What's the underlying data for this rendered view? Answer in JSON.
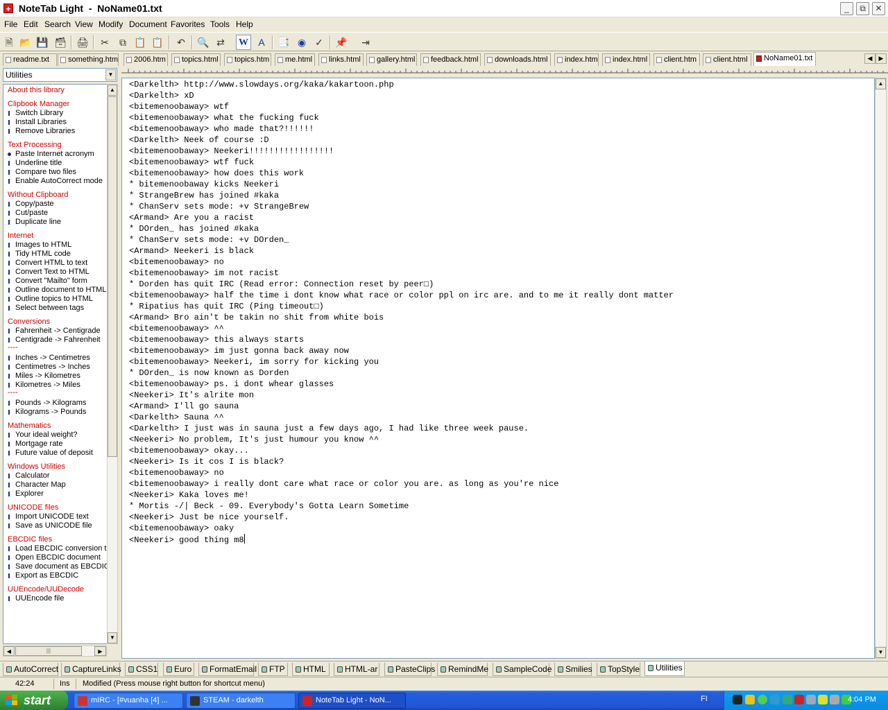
{
  "window": {
    "title": "NoteTab Light  -  NoName01.txt"
  },
  "menu": [
    "File",
    "Edit",
    "Search",
    "View",
    "Modify",
    "Document",
    "Favorites",
    "Tools",
    "Help"
  ],
  "toolbar": {
    "icons": [
      "new-icon",
      "open-icon",
      "save-icon",
      "save-all-icon",
      "print-icon",
      "cut-icon",
      "copy-icon",
      "paste-icon",
      "paste-special-icon",
      "undo-icon",
      "find-icon",
      "replace-icon",
      "word-wrap-icon",
      "font-icon",
      "outline-icon",
      "preview-icon",
      "spell-check-icon",
      "clipbook-icon",
      "exit-icon"
    ]
  },
  "tabs": [
    "readme.txt",
    "something.html",
    "2006.htm",
    "topics.html",
    "topics.htm",
    "me.html",
    "links.html",
    "gallery.html",
    "feedback.html",
    "downloads.html",
    "index.htm",
    "index.html",
    "client.htm",
    "client.html",
    "NoName01.txt"
  ],
  "library": {
    "selected": "Utilities"
  },
  "clip_items": [
    {
      "t": "h",
      "v": "About this library"
    },
    {
      "t": "g"
    },
    {
      "t": "h",
      "v": "Clipbook Manager"
    },
    {
      "t": "i",
      "v": "Switch Library"
    },
    {
      "t": "i",
      "v": "Install Libraries"
    },
    {
      "t": "i",
      "v": "Remove Libraries"
    },
    {
      "t": "g"
    },
    {
      "t": "h",
      "v": "Text Processing"
    },
    {
      "t": "b",
      "v": "Paste Internet acronym"
    },
    {
      "t": "i",
      "v": "Underline title"
    },
    {
      "t": "i",
      "v": "Compare two files"
    },
    {
      "t": "i",
      "v": "Enable AutoCorrect mode"
    },
    {
      "t": "g"
    },
    {
      "t": "h",
      "v": "Without Clipboard"
    },
    {
      "t": "i",
      "v": "Copy/paste"
    },
    {
      "t": "i",
      "v": "Cut/paste"
    },
    {
      "t": "i",
      "v": "Duplicate line"
    },
    {
      "t": "g"
    },
    {
      "t": "h",
      "v": "Internet"
    },
    {
      "t": "i",
      "v": "Images to HTML"
    },
    {
      "t": "i",
      "v": "Tidy HTML code"
    },
    {
      "t": "i",
      "v": "Convert HTML to text"
    },
    {
      "t": "i",
      "v": "Convert Text to HTML"
    },
    {
      "t": "i",
      "v": "Convert \"Mailto\" form"
    },
    {
      "t": "i",
      "v": "Outline document to HTML"
    },
    {
      "t": "i",
      "v": "Outline topics to HTML"
    },
    {
      "t": "i",
      "v": "Select between tags"
    },
    {
      "t": "g"
    },
    {
      "t": "h",
      "v": "Conversions"
    },
    {
      "t": "i",
      "v": "Fahrenheit -> Centigrade"
    },
    {
      "t": "i",
      "v": "Centigrade -> Fahrenheit"
    },
    {
      "t": "s",
      "v": "----"
    },
    {
      "t": "i",
      "v": "Inches -> Centimetres"
    },
    {
      "t": "i",
      "v": "Centimetres -> Inches"
    },
    {
      "t": "i",
      "v": "Miles -> Kilometres"
    },
    {
      "t": "i",
      "v": "Kilometres -> Miles"
    },
    {
      "t": "s",
      "v": "----"
    },
    {
      "t": "i",
      "v": "Pounds -> Kilograms"
    },
    {
      "t": "i",
      "v": "Kilograms -> Pounds"
    },
    {
      "t": "g"
    },
    {
      "t": "h",
      "v": "Mathematics"
    },
    {
      "t": "i",
      "v": "Your ideal weight?"
    },
    {
      "t": "i",
      "v": "Mortgage rate"
    },
    {
      "t": "i",
      "v": "Future value of deposit"
    },
    {
      "t": "g"
    },
    {
      "t": "h",
      "v": "Windows Utilities"
    },
    {
      "t": "i",
      "v": "Calculator"
    },
    {
      "t": "i",
      "v": "Character Map"
    },
    {
      "t": "i",
      "v": "Explorer"
    },
    {
      "t": "g"
    },
    {
      "t": "h",
      "v": "UNICODE files"
    },
    {
      "t": "i",
      "v": "Import UNICODE text"
    },
    {
      "t": "i",
      "v": "Save as UNICODE file"
    },
    {
      "t": "g"
    },
    {
      "t": "h",
      "v": "EBCDIC files"
    },
    {
      "t": "i",
      "v": "Load EBCDIC conversion t"
    },
    {
      "t": "i",
      "v": "Open EBCDIC document"
    },
    {
      "t": "i",
      "v": "Save document as EBCDIC"
    },
    {
      "t": "i",
      "v": "Export as EBCDIC"
    },
    {
      "t": "g"
    },
    {
      "t": "h",
      "v": "UUEncode/UUDecode"
    },
    {
      "t": "i",
      "v": "UUEncode file"
    }
  ],
  "document": {
    "lines": [
      "<Darkelth> http://www.slowdays.org/kaka/kakartoon.php",
      "<Darkelth> xD",
      "<bitemenoobaway> wtf",
      "<bitemenoobaway> what the fucking fuck",
      "<bitemenoobaway> who made that?!!!!!!",
      "<Darkelth> Neek of course :D",
      "<bitemenoobaway> Neekeri!!!!!!!!!!!!!!!!!",
      "<bitemenoobaway> wtf fuck",
      "<bitemenoobaway> how does this work",
      "* bitemenoobaway kicks Neekeri",
      "* StrangeBrew has joined #kaka",
      "* ChanServ sets mode: +v StrangeBrew",
      "<Armand> Are you a racist",
      "* DOrden_ has joined #kaka",
      "* ChanServ sets mode: +v DOrden_",
      "<Armand> Neekeri is black",
      "<bitemenoobaway> no",
      "<bitemenoobaway> im not racist",
      "* Dorden has quit IRC (Read error: Connection reset by peer□)",
      "<bitemenoobaway> half the time i dont know what race or color ppl on irc are. and to me it really dont matter",
      "* Ripatius has quit IRC (Ping timeout□)",
      "<Armand> Bro ain't be takin no shit from white bois",
      "<bitemenoobaway> ^^",
      "<bitemenoobaway> this always starts",
      "<bitemenoobaway> im just gonna back away now",
      "<bitemenoobaway> Neekeri, im sorry for kicking you",
      "* DOrden_ is now known as Dorden",
      "<bitemenoobaway> ps. i dont whear glasses",
      "<Neekeri> It's alrite mon",
      "<Armand> I'll go sauna",
      "<Darkelth> Sauna ^^",
      "<Darkelth> I just was in sauna just a few days ago, I had like three week pause.",
      "<Neekeri> No problem, It's just humour you know ^^",
      "<bitemenoobaway> okay...",
      "<Neekeri> Is it cos I is black?",
      "<bitemenoobaway> no",
      "<bitemenoobaway> i really dont care what race or color you are. as long as you're nice",
      "<Neekeri> Kaka loves me!",
      "* Mortis -/| Beck - 09. Everybody's Gotta Learn Sometime",
      "<Neekeri> Just be nice yourself.",
      "<bitemenoobaway> oaky",
      "<Neekeri> good thing m8"
    ]
  },
  "bottom_tabs": [
    "AutoCorrect",
    "CaptureLinks",
    "CSS1",
    "Euro",
    "FormatEmail",
    "FTP",
    "HTML",
    "HTML-ar",
    "PasteClips",
    "RemindMe",
    "SampleCode",
    "Smilies",
    "TopStyle",
    "Utilities"
  ],
  "status": {
    "position": "42:24",
    "mode": "Ins",
    "message": "Modified  (Press mouse right button for shortcut menu)"
  },
  "taskbar": {
    "start": "start",
    "tasks": [
      "mIRC - [#vuanha [4] ...",
      "STEAM - darkelth",
      "NoteTab Light  -  NoN..."
    ],
    "lang": "FI",
    "clock": "4:04 PM"
  }
}
